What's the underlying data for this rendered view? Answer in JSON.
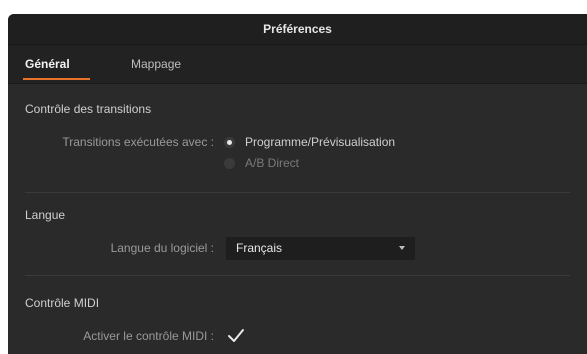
{
  "window": {
    "title": "Préférences"
  },
  "tabs": [
    {
      "label": "Général",
      "active": true
    },
    {
      "label": "Mappage",
      "active": false
    }
  ],
  "transitions": {
    "title": "Contrôle des transitions",
    "row_label": "Transitions exécutées avec :",
    "options": [
      {
        "label": "Programme/Prévisualisation",
        "selected": true
      },
      {
        "label": "A/B Direct",
        "selected": false
      }
    ]
  },
  "language": {
    "title": "Langue",
    "row_label": "Langue du logiciel :",
    "selected_value": "Français"
  },
  "midi": {
    "title": "Contrôle MIDI",
    "row_label": "Activer le contrôle MIDI :",
    "checked": true
  },
  "colors": {
    "accent": "#e8742a",
    "background": "#2a2a2a",
    "titlebar": "#1f1f1f"
  },
  "icons": {
    "dropdown": "chevron-down-icon",
    "checkbox": "checkmark-icon"
  }
}
